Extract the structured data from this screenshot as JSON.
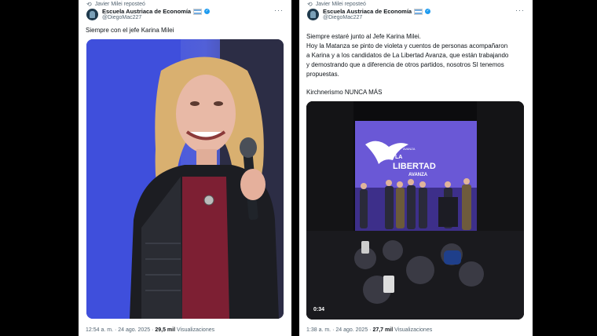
{
  "tweets": [
    {
      "reposted_by": "Javier Milei reposteó",
      "author_name": "Escuela Austriaca de Economía",
      "author_handle": "@DiegoMac227",
      "text": "Siempre con el jefe Karina Milei",
      "time": "12:54 a. m. · 24 ago. 2025 ·",
      "views": "29,5 mil",
      "views_label": "Visualizaciones"
    },
    {
      "reposted_by": "Javier Milei reposteó",
      "author_name": "Escuela Austriaca de Economía",
      "author_handle": "@DiegoMac227",
      "text_lines": [
        "Siempre estaré junto al Jefe Karina Milei.",
        "Hoy la Matanza se pinto de violeta y cuentos de personas acompañaron",
        "a Karina y a los candidatos de La Libertad Avanza, que están trabajando",
        "y demostrando que a diferencia de otros partidos, nosotros SI tenemos",
        "propuestas.",
        "Kirchnerismo NUNCA MÁS"
      ],
      "video_duration": "0:34",
      "screen_text": {
        "small": "AVANZA",
        "la": "LA",
        "libertad": "LIBERTAD",
        "avanza": "AVANZA"
      },
      "time": "1:38 a. m. · 24 ago. 2025 ·",
      "views": "27,7 mil",
      "views_label": "Visualizaciones"
    }
  ],
  "icons": {
    "repost": "repost-icon",
    "more": "more-icon",
    "verified": "verified-badge-icon",
    "flag": "argentina-flag-icon"
  }
}
